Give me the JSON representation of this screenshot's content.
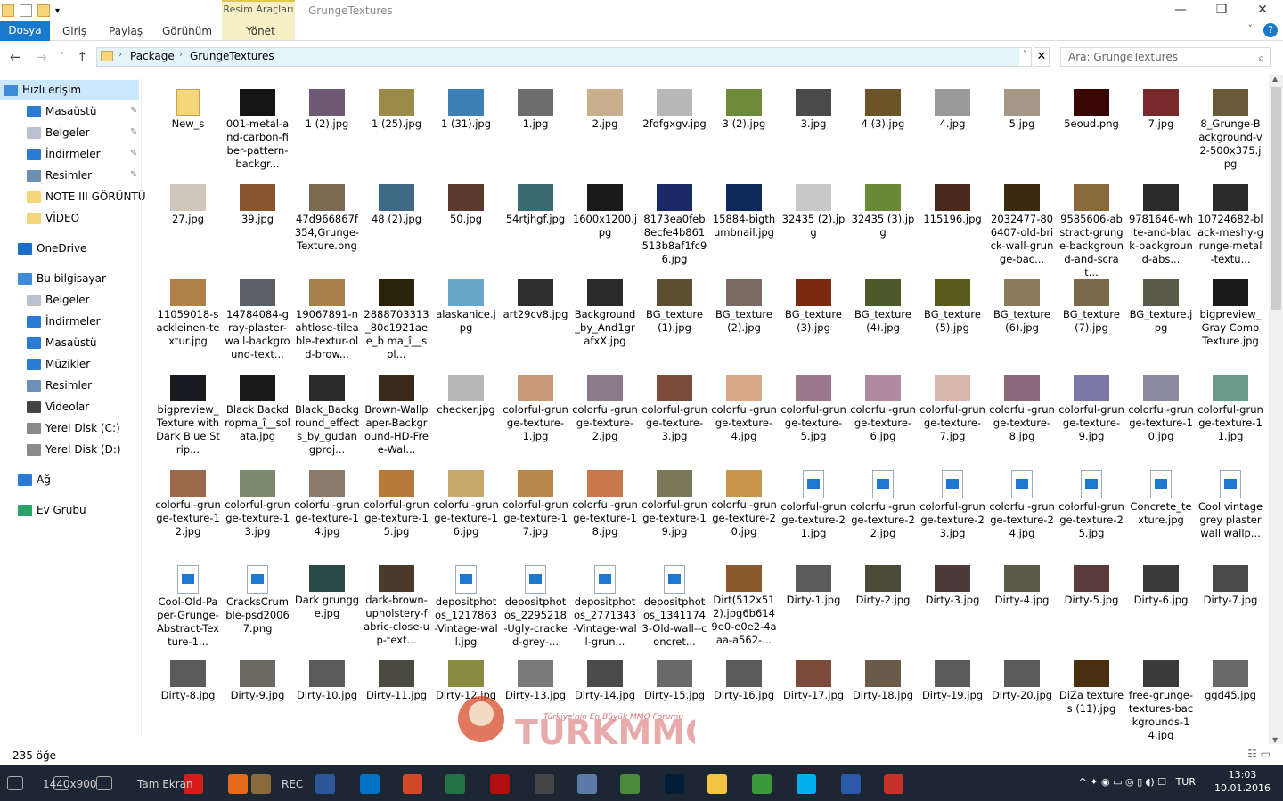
{
  "window": {
    "title": "GrungeTextures",
    "context_tab": "Resim Araçları",
    "context_sub": "Yönet",
    "min": "—",
    "max": "❐",
    "close": "✕"
  },
  "ribbon": {
    "file": "Dosya",
    "tabs": [
      "Giriş",
      "Paylaş",
      "Görünüm"
    ],
    "help": "?",
    "collapse": "˅"
  },
  "nav": {
    "back": "←",
    "forward": "→",
    "recent": "˅",
    "up": "↑"
  },
  "address": {
    "crumbs": [
      "Package",
      "GrungeTextures"
    ],
    "sep": "›",
    "dropdown": "˅",
    "clear": "✕"
  },
  "search": {
    "placeholder": "Ara: GrungeTextures",
    "icon": "⌕"
  },
  "sidebar": [
    {
      "label": "Hızlı erişim",
      "icon": "star-icon",
      "color": "#3c8ad8",
      "indent": 4,
      "sel": true,
      "pin": false
    },
    {
      "label": "Masaüstü",
      "icon": "desktop-icon",
      "color": "#2b7bd4",
      "indent": 30,
      "pin": true
    },
    {
      "label": "Belgeler",
      "icon": "documents-icon",
      "color": "#b9c3cf",
      "indent": 30,
      "pin": true
    },
    {
      "label": "İndirmeler",
      "icon": "download-icon",
      "color": "#2b7bd4",
      "indent": 30,
      "pin": true
    },
    {
      "label": "Resimler",
      "icon": "pictures-icon",
      "color": "#6d8fb3",
      "indent": 30,
      "pin": true
    },
    {
      "label": "NOTE III GÖRÜNTÜ",
      "icon": "folder-icon",
      "color": "#f5d67c",
      "indent": 30,
      "pin": false
    },
    {
      "label": "VİDEO",
      "icon": "folder-icon",
      "color": "#f5d67c",
      "indent": 30,
      "pin": false
    },
    {
      "label": "OneDrive",
      "icon": "onedrive-icon",
      "color": "#1c6fc7",
      "indent": 20,
      "pin": false,
      "gap": true
    },
    {
      "label": "Bu bilgisayar",
      "icon": "computer-icon",
      "color": "#3c8ad8",
      "indent": 20,
      "pin": false,
      "gap": true
    },
    {
      "label": "Belgeler",
      "icon": "documents-icon",
      "color": "#b9c3cf",
      "indent": 30,
      "pin": false
    },
    {
      "label": "İndirmeler",
      "icon": "download-icon",
      "color": "#2b7bd4",
      "indent": 30,
      "pin": false
    },
    {
      "label": "Masaüstü",
      "icon": "desktop-icon",
      "color": "#2b7bd4",
      "indent": 30,
      "pin": false
    },
    {
      "label": "Müzikler",
      "icon": "music-icon",
      "color": "#2b7bd4",
      "indent": 30,
      "pin": false
    },
    {
      "label": "Resimler",
      "icon": "pictures-icon",
      "color": "#6d8fb3",
      "indent": 30,
      "pin": false
    },
    {
      "label": "Videolar",
      "icon": "video-icon",
      "color": "#444",
      "indent": 30,
      "pin": false
    },
    {
      "label": "Yerel Disk (C:)",
      "icon": "drive-icon",
      "color": "#8a8a8a",
      "indent": 30,
      "pin": false
    },
    {
      "label": "Yerel Disk (D:)",
      "icon": "drive-icon",
      "color": "#8a8a8a",
      "indent": 30,
      "pin": false
    },
    {
      "label": "Ağ",
      "icon": "network-icon",
      "color": "#2b7bd4",
      "indent": 20,
      "pin": false,
      "gap": true
    },
    {
      "label": "Ev Grubu",
      "icon": "homegroup-icon",
      "color": "#2aa36b",
      "indent": 20,
      "pin": false,
      "gap": true
    }
  ],
  "pin_glyph": "✎",
  "files": [
    [
      "New_s",
      "folder"
    ],
    [
      "001-metal-and-carbon-fiber-pattern-backgr...",
      "#141414"
    ],
    [
      "1 (2).jpg",
      "#6e5a72"
    ],
    [
      "1 (25).jpg",
      "#9b8a48"
    ],
    [
      "1 (31).jpg",
      "#3d7fb7"
    ],
    [
      "1.jpg",
      "#6d6d6d"
    ],
    [
      "2.jpg",
      "#c8b08e"
    ],
    [
      "2fdfgxgv.jpg",
      "#b8b8b8"
    ],
    [
      "3 (2).jpg",
      "#6f8a3a"
    ],
    [
      "3.jpg",
      "#4a4a4a"
    ],
    [
      "4 (3).jpg",
      "#6a5428"
    ],
    [
      "4.jpg",
      "#9a9a9a"
    ],
    [
      "5.jpg",
      "#a69886"
    ],
    [
      "5eoud.png",
      "#3a0505"
    ],
    [
      "7.jpg",
      "#7a2a2a"
    ],
    [
      "8_Grunge-Background-v2-500x375.jpg",
      "#6a5a3a"
    ],
    [
      "27.jpg",
      "#d0c8bc"
    ],
    [
      "39.jpg",
      "#8a5430"
    ],
    [
      "47d966867f354,Grunge-Texture.png",
      "#7a6a52"
    ],
    [
      "48 (2).jpg",
      "#3f6a86"
    ],
    [
      "50.jpg",
      "#5a3a2a"
    ],
    [
      "54rtjhgf.jpg",
      "#3a6a72"
    ],
    [
      "1600x1200.jpg",
      "#1a1a1a"
    ],
    [
      "8173ea0feb8ecfe4b861513b8af1fc96.jpg",
      "#1a2a66"
    ],
    [
      "15884-bigthumbnail.jpg",
      "#0a2a5a"
    ],
    [
      "32435 (2).jpg",
      "#c8c8c8"
    ],
    [
      "32435 (3).jpg",
      "#6a8a3a"
    ],
    [
      "115196.jpg",
      "#4a2a1a"
    ],
    [
      "2032477-806407-old-brick-wall-grunge-bac...",
      "#3a2a10"
    ],
    [
      "9585606-abstract-grunge-background-and-scrat...",
      "#8a6a3a"
    ],
    [
      "9781646-white-and-black-background-abs...",
      "#2a2a2a"
    ],
    [
      "10724682-black-meshy-grunge-metal-textu...",
      "#2a2a2a"
    ],
    [
      "11059018-sackleinen-textur.jpg",
      "#b0804a"
    ],
    [
      "14784084-gray-plaster-wall-background-text...",
      "#5a6068"
    ],
    [
      "19067891-nahtlose-tileable-textur-old-brow...",
      "#a8804a"
    ],
    [
      "2888703313_80c1921aee_b ma_î__sol...",
      "#2a2208"
    ],
    [
      "alaskanice.jpg",
      "#6aa6c8"
    ],
    [
      "art29cv8.jpg",
      "#2e2e2e"
    ],
    [
      "Background_by_And1grafxX.jpg",
      "#2a2a2a"
    ],
    [
      "BG_texture (1).jpg",
      "#5a5030"
    ],
    [
      "BG_texture (2).jpg",
      "#7a6a62"
    ],
    [
      "BG_texture (3).jpg",
      "#7a2a10"
    ],
    [
      "BG_texture (4).jpg",
      "#4a5a2a"
    ],
    [
      "BG_texture (5).jpg",
      "#5a5a1a"
    ],
    [
      "BG_texture (6).jpg",
      "#8a7a58"
    ],
    [
      "BG_texture (7).jpg",
      "#7a6a4a"
    ],
    [
      "BG_texture.jpg",
      "#5a5a4a"
    ],
    [
      "bigpreview_Gray Comb Texture.jpg",
      "#1a1a1a"
    ],
    [
      "bigpreview_Texture with Dark Blue Strip...",
      "#1a1c22"
    ],
    [
      "Black Backdropma_î__solata.jpg",
      "#1a1a1a"
    ],
    [
      "Black_Background_effects_by_gudangproj...",
      "#2a2a2a"
    ],
    [
      "Brown-Wallpaper-Background-HD-Free-Wal...",
      "#3a2a1a"
    ],
    [
      "checker.jpg",
      "#b8b8b8"
    ],
    [
      "colorful-grunge-texture-1.jpg",
      "#c89a7a"
    ],
    [
      "colorful-grunge-texture-2.jpg",
      "#8a7a8a"
    ],
    [
      "colorful-grunge-texture-3.jpg",
      "#7a4a3a"
    ],
    [
      "colorful-grunge-texture-4.jpg",
      "#d8a888"
    ],
    [
      "colorful-grunge-texture-5.jpg",
      "#9a7a8a"
    ],
    [
      "colorful-grunge-texture-6.jpg",
      "#b08aa0"
    ],
    [
      "colorful-grunge-texture-7.jpg",
      "#d8b8a8"
    ],
    [
      "colorful-grunge-texture-8.jpg",
      "#8a6a7a"
    ],
    [
      "colorful-grunge-texture-9.jpg",
      "#7a7aa8"
    ],
    [
      "colorful-grunge-texture-10.jpg",
      "#8a8aa0"
    ],
    [
      "colorful-grunge-texture-11.jpg",
      "#6a9a8a"
    ],
    [
      "colorful-grunge-texture-12.jpg",
      "#9a6a4a"
    ],
    [
      "colorful-grunge-texture-13.jpg",
      "#7a8a6a"
    ],
    [
      "colorful-grunge-texture-14.jpg",
      "#8a7a6a"
    ],
    [
      "colorful-grunge-texture-15.jpg",
      "#b87a3a"
    ],
    [
      "colorful-grunge-texture-16.jpg",
      "#c8a86a"
    ],
    [
      "colorful-grunge-texture-17.jpg",
      "#b8884a"
    ],
    [
      "colorful-grunge-texture-18.jpg",
      "#c8784a"
    ],
    [
      "colorful-grunge-texture-19.jpg",
      "#7a7a5a"
    ],
    [
      "colorful-grunge-texture-20.jpg",
      "#c8944a"
    ],
    [
      "colorful-grunge-texture-21.jpg",
      "image"
    ],
    [
      "colorful-grunge-texture-22.jpg",
      "image"
    ],
    [
      "colorful-grunge-texture-23.jpg",
      "image"
    ],
    [
      "colorful-grunge-texture-24.jpg",
      "image"
    ],
    [
      "colorful-grunge-texture-25.jpg",
      "image"
    ],
    [
      "Concrete_texture.jpg",
      "image"
    ],
    [
      "Cool vintage grey plaster wall wallp...",
      "image"
    ],
    [
      "Cool-Old-Paper-Grunge-Abstract-Texture-1...",
      "image"
    ],
    [
      "CracksCrumble-psd20067.png",
      "image"
    ],
    [
      "Dark grungge.jpg",
      "#2a4a4a"
    ],
    [
      "dark-brown-upholstery-fabric-close-up-text...",
      "#4a3a2a"
    ],
    [
      "depositphotos_1217863-Vintage-wall.jpg",
      "image"
    ],
    [
      "depositphotos_2295218-Ugly-cracked-grey-...",
      "image"
    ],
    [
      "depositphotos_2771343-Vintage-wall-grun...",
      "image"
    ],
    [
      "depositphotos_13411743-Old-wall--concret...",
      "image"
    ],
    [
      "Dirt(512x512).jpg6b6149e0-e0e2-4aaa-a562-...",
      "#8a5a2a"
    ],
    [
      "Dirty-1.jpg",
      "#5a5a5a"
    ],
    [
      "Dirty-2.jpg",
      "#4a4a3a"
    ],
    [
      "Dirty-3.jpg",
      "#4a3a3a"
    ],
    [
      "Dirty-4.jpg",
      "#5a5a4a"
    ],
    [
      "Dirty-5.jpg",
      "#5a3a3a"
    ],
    [
      "Dirty-6.jpg",
      "#3a3a3a"
    ],
    [
      "Dirty-7.jpg",
      "#4a4a4a"
    ],
    [
      "Dirty-8.jpg",
      "#5a5a5a"
    ],
    [
      "Dirty-9.jpg",
      "#6a6a60"
    ],
    [
      "Dirty-10.jpg",
      "#5a5a5a"
    ],
    [
      "Dirty-11.jpg",
      "#4a4a40"
    ],
    [
      "Dirty-12.jpg",
      "#8a8a40"
    ],
    [
      "Dirty-13.jpg",
      "#7a7a7a"
    ],
    [
      "Dirty-14.jpg",
      "#4a4a4a"
    ],
    [
      "Dirty-15.jpg",
      "#6a6a6a"
    ],
    [
      "Dirty-16.jpg",
      "#5a5a5a"
    ],
    [
      "Dirty-17.jpg",
      "#7a4a3a"
    ],
    [
      "Dirty-18.jpg",
      "#6a5a4a"
    ],
    [
      "Dirty-19.jpg",
      "#5a5a5a"
    ],
    [
      "Dirty-20.jpg",
      "#5a5a5a"
    ],
    [
      "DiZa textures (11).jpg",
      "#4a3010"
    ],
    [
      "free-grunge-textures-backgrounds-14.jpg",
      "#3a3a3a"
    ],
    [
      "ggd45.jpg",
      "#6a6a6a"
    ]
  ],
  "status": {
    "count": "235 öğe",
    "views": "☷ ▭"
  },
  "taskbar": {
    "items": [
      {
        "icon": "start-icon",
        "color": "#1c2733"
      },
      {
        "icon": "search-icon",
        "color": "#1c2733"
      },
      {
        "icon": "task-view-icon",
        "color": "#1c2733"
      },
      {
        "icon": "opera-icon",
        "color": "#d71a1a"
      },
      {
        "icon": "firefox-icon",
        "color": "#e66a1a"
      },
      {
        "icon": "camera-icon",
        "color": "#8a6a3a"
      },
      {
        "icon": "word-icon",
        "color": "#2b579a"
      },
      {
        "icon": "outlook-icon",
        "color": "#0072c6"
      },
      {
        "icon": "powerpoint-icon",
        "color": "#d24726"
      },
      {
        "icon": "excel-icon",
        "color": "#217346"
      },
      {
        "icon": "record-icon",
        "color": "#b01010"
      },
      {
        "icon": "sync-icon",
        "color": "#444"
      },
      {
        "icon": "network-tool-icon",
        "color": "#5a7aa8"
      },
      {
        "icon": "chart-app-icon",
        "color": "#4a8a3a"
      },
      {
        "icon": "photoshop-icon",
        "color": "#001e36"
      },
      {
        "icon": "explorer-icon",
        "color": "#f5c542"
      },
      {
        "icon": "chrome-icon",
        "color": "#3a9a3a"
      },
      {
        "icon": "skype-icon",
        "color": "#00aff0"
      },
      {
        "icon": "moon-app-icon",
        "color": "#2a5aa8"
      },
      {
        "icon": "flag-app-icon",
        "color": "#c8302a"
      }
    ],
    "texts": [
      "1440x900",
      "Tam Ekran",
      "REC"
    ],
    "tray": "^  ✦  ◉  ▭  ◎  ▯  ◖)  ☐",
    "lang": "TUR",
    "time": "13:03",
    "date": "10.01.2016"
  },
  "watermark": {
    "brand": "TURKMMO",
    "tagline": "Türkiye'nin En Büyük MMO Forumu"
  }
}
